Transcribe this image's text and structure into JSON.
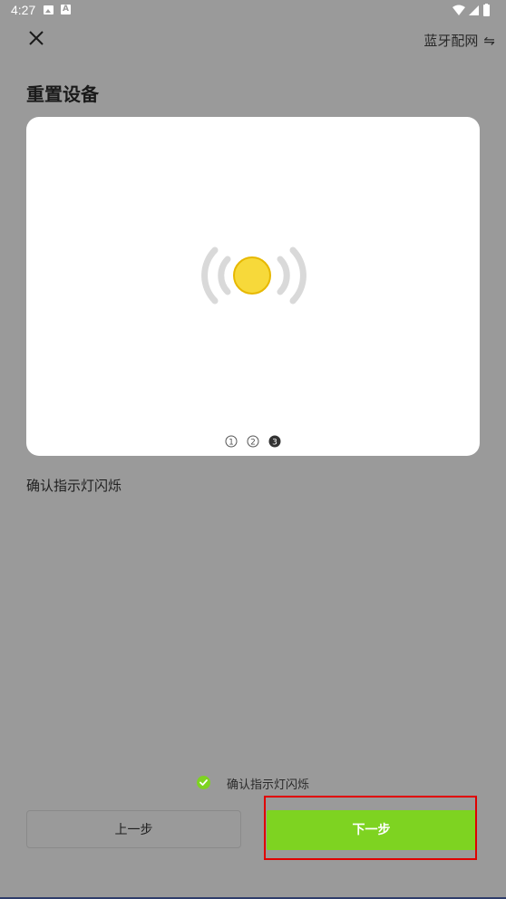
{
  "status_bar": {
    "time": "4:27",
    "icons": [
      "gallery-icon",
      "a-icon",
      "wifi-icon",
      "signal-icon",
      "battery-icon"
    ]
  },
  "header": {
    "close_icon": "close-icon",
    "mode_label": "蓝牙配网",
    "mode_icon": "swap-arrows-icon"
  },
  "page": {
    "title": "重置设备",
    "description": "确认指示灯闪烁",
    "steps": [
      "①",
      "②",
      "③"
    ],
    "current_step": 3
  },
  "confirm": {
    "label": "确认指示灯闪烁",
    "checked": true
  },
  "buttons": {
    "prev_label": "上一步",
    "next_label": "下一步"
  },
  "colors": {
    "accent": "#7ed321",
    "overlay": "#9a9a9a",
    "highlight": "#e00000",
    "bulb": "#f7d93a"
  }
}
